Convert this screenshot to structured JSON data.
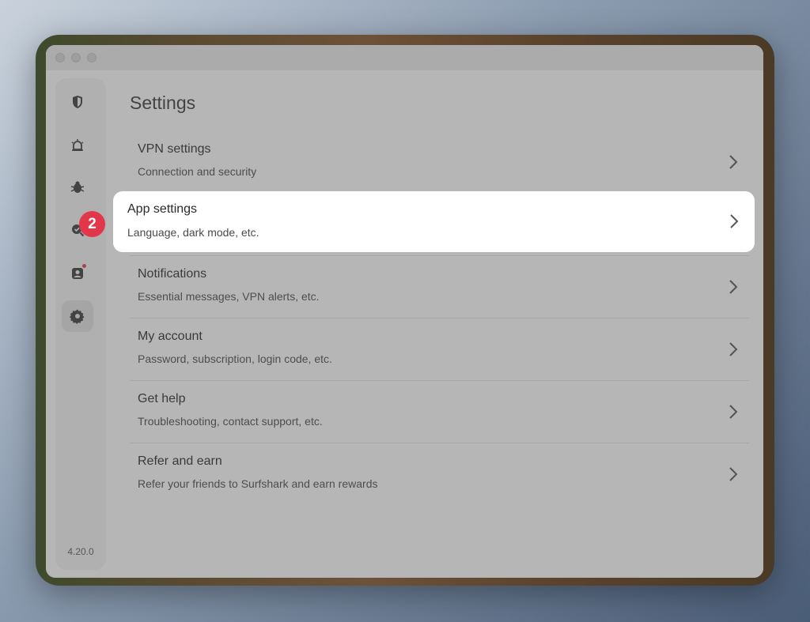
{
  "window": {
    "title_dots": [
      "close",
      "minimize",
      "zoom"
    ]
  },
  "sidebar": {
    "items": [
      {
        "name": "vpn-shield-icon",
        "active": false
      },
      {
        "name": "alert-icon",
        "active": false
      },
      {
        "name": "antivirus-bug-icon",
        "active": false
      },
      {
        "name": "search-check-icon",
        "active": false
      },
      {
        "name": "contacts-icon",
        "active": false,
        "notification": true
      },
      {
        "name": "gear-icon",
        "active": true
      }
    ],
    "version": "4.20.0"
  },
  "main": {
    "title": "Settings",
    "rows": [
      {
        "title": "VPN settings",
        "subtitle": "Connection and security"
      },
      {
        "title": "App settings",
        "subtitle": "Language, dark mode, etc."
      },
      {
        "title": "Notifications",
        "subtitle": "Essential messages, VPN alerts, etc."
      },
      {
        "title": "My account",
        "subtitle": "Password, subscription, login code, etc."
      },
      {
        "title": "Get help",
        "subtitle": "Troubleshooting, contact support, etc."
      },
      {
        "title": "Refer and earn",
        "subtitle": "Refer your friends to Surfshark and earn rewards"
      }
    ]
  },
  "annotation": {
    "step_badge": "2"
  },
  "colors": {
    "badge": "#e2364a",
    "notification_dot": "#e0404b",
    "overlay": "rgba(80,80,80,0.42)"
  }
}
